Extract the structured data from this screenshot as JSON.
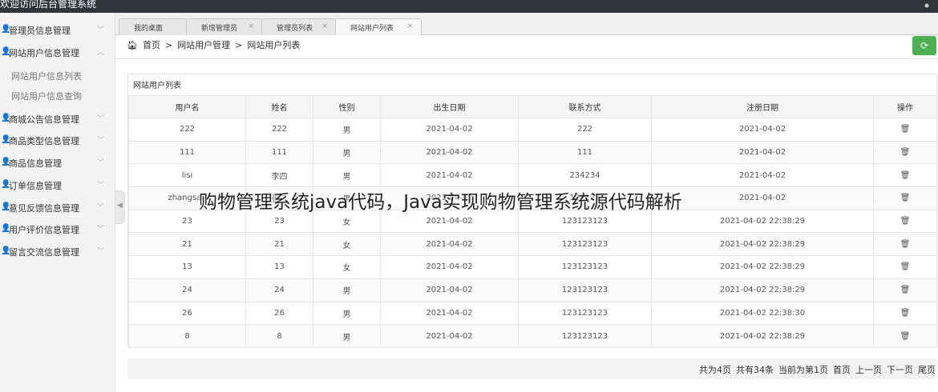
{
  "app": {
    "title": "欢迎访问后台管理系统"
  },
  "sidebar": {
    "items": [
      {
        "label": "管理员信息管理",
        "expanded": false
      },
      {
        "label": "网站用户信息管理",
        "expanded": true,
        "children": [
          "网站用户信息列表",
          "网站用户信息查询"
        ]
      },
      {
        "label": "商城公告信息管理",
        "expanded": false
      },
      {
        "label": "商品类型信息管理",
        "expanded": false
      },
      {
        "label": "商品信息管理",
        "expanded": false
      },
      {
        "label": "订单信息管理",
        "expanded": false
      },
      {
        "label": "意见反馈信息管理",
        "expanded": false
      },
      {
        "label": "用户评价信息管理",
        "expanded": false
      },
      {
        "label": "留言交流信息管理",
        "expanded": false
      }
    ]
  },
  "tabs": [
    {
      "label": "我的桌面",
      "active": false
    },
    {
      "label": "新增管理员",
      "active": false
    },
    {
      "label": "管理员列表",
      "active": false
    },
    {
      "label": "网站用户列表",
      "active": true
    }
  ],
  "breadcrumb": [
    "首页",
    "网站用户管理",
    "网站用户列表"
  ],
  "panel": {
    "title": "网站用户列表"
  },
  "table": {
    "columns": [
      "用户名",
      "姓名",
      "性别",
      "出生日期",
      "联系方式",
      "注册日期",
      "操作"
    ],
    "rows": [
      [
        "222",
        "222",
        "男",
        "2021-04-02",
        "222",
        "2021-04-02"
      ],
      [
        "111",
        "111",
        "男",
        "2021-04-02",
        "111",
        "2021-04-02"
      ],
      [
        "lisi",
        "李四",
        "男",
        "2021-04-02",
        "234234",
        "2021-04-02"
      ],
      [
        "zhangsan",
        "张三",
        "男",
        "2021-04-02",
        "123123",
        "2021-04-02"
      ],
      [
        "23",
        "23",
        "女",
        "2021-04-02",
        "123123123",
        "2021-04-02 22:38:29"
      ],
      [
        "21",
        "21",
        "女",
        "2021-04-02",
        "123123123",
        "2021-04-02 22:38:29"
      ],
      [
        "13",
        "13",
        "女",
        "2021-04-02",
        "123123123",
        "2021-04-02 22:38:29"
      ],
      [
        "24",
        "24",
        "男",
        "2021-04-02",
        "123123123",
        "2021-04-02 22:38:29"
      ],
      [
        "26",
        "26",
        "男",
        "2021-04-02",
        "123123123",
        "2021-04-02 22:38:30"
      ],
      [
        "8",
        "8",
        "男",
        "2021-04-02",
        "123123123",
        "2021-04-02 22:38:29"
      ]
    ]
  },
  "pagination": {
    "total_pages": "共为4页",
    "total_records": "共有34条",
    "current": "当前为第1页",
    "first": "首页",
    "prev": "上一页",
    "next": "下一页",
    "last": "尾页"
  },
  "watermark": "购物管理系统java代码，Java实现购物管理系统源代码解析",
  "icons": {
    "user": "user-icon",
    "chevron": "chevron-icon",
    "home": "home-icon",
    "refresh": "refresh-icon",
    "trash": "trash-icon",
    "close": "close-icon"
  },
  "colors": {
    "topbar": "#2f353a",
    "accent": "#4caf50",
    "sidebar": "#f3f3f4"
  }
}
